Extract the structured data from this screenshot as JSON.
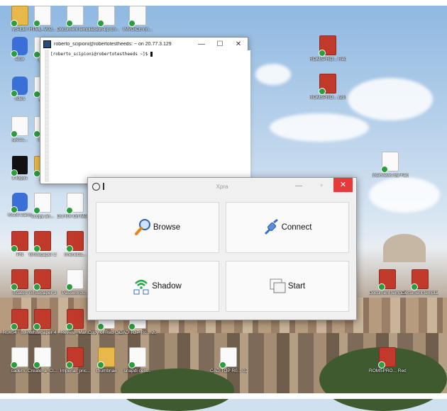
{
  "desktop": {
    "icons": [
      {
        "label": "yS-Elin",
        "kind": "folder"
      },
      {
        "label": "HTML_V02...",
        "kind": "doc"
      },
      {
        "label": "Document templates",
        "kind": "doc"
      },
      {
        "label": "Sign-up ch...",
        "kind": "doc"
      },
      {
        "label": "INVOICE (in...",
        "kind": "doc"
      },
      {
        "label": "efox",
        "kind": "app"
      },
      {
        "label": "Rec",
        "kind": "doc"
      },
      {
        "label": "ndes",
        "kind": "app"
      },
      {
        "label": "Wo",
        "kind": "doc"
      },
      {
        "label": "gress...",
        "kind": "doc"
      },
      {
        "label": "mtov",
        "kind": "doc"
      },
      {
        "label": "k-logos",
        "kind": "black"
      },
      {
        "label": "ph",
        "kind": "folder"
      },
      {
        "label": "rosoft eams",
        "kind": "app"
      },
      {
        "label": "ecopy an...",
        "kind": "doc"
      },
      {
        "label": "Dst RX-Off Mer-Ltcy-Ag...",
        "kind": "doc"
      },
      {
        "label": "PN",
        "kind": "pdf"
      },
      {
        "label": "Whitepaper 2",
        "kind": "pdf"
      },
      {
        "label": "Imeneba...",
        "kind": "pdf"
      },
      {
        "label": "ificates",
        "kind": "pdf"
      },
      {
        "label": "Whitepaper 3",
        "kind": "pdf"
      },
      {
        "label": "Passwords...",
        "kind": "doc"
      },
      {
        "label": "R0X04 - 03-No...",
        "kind": "pdf"
      },
      {
        "label": "Whitepaper 4",
        "kind": "pdf"
      },
      {
        "label": "Review_Mar...",
        "kind": "pdf"
      },
      {
        "label": "Copy of Red Oak...",
        "kind": "doc"
      },
      {
        "label": "CAD TOP Ro... 20-FEB-23...",
        "kind": "doc"
      },
      {
        "label": "cadem...",
        "kind": "doc"
      },
      {
        "label": "Create_a_Cl...",
        "kind": "doc"
      },
      {
        "label": "Imperial_pric...",
        "kind": "pdf"
      },
      {
        "label": "thumbnail",
        "kind": "folder"
      },
      {
        "label": "snapdi cent...",
        "kind": "doc"
      },
      {
        "label": "CAD TOP R0... 02-Feb-23...",
        "kind": "doc"
      },
      {
        "label": "ROMSPRO... Red Oak M...",
        "kind": "pdf"
      },
      {
        "label": "ROMSPRO... (2) Mer Co...",
        "kind": "pdf"
      },
      {
        "label": "Interviews By Faculty",
        "kind": "doc"
      },
      {
        "label": "Document template",
        "kind": "pdf"
      },
      {
        "label": "Document template2",
        "kind": "pdf"
      },
      {
        "label": "ROMSPRO... Red Oak M...",
        "kind": "pdf"
      }
    ]
  },
  "terminal": {
    "title": "roberto_scipioni@robertotestheeds: ~ on 20.77.3.129",
    "prompt": "[roberto_scipioni@robertotestheeds ~]$ ",
    "minimize": "—",
    "maximize": "☐",
    "close": "✕"
  },
  "xpra": {
    "title": "Xpra",
    "minimize": "—",
    "maximize": "▫",
    "close": "✕",
    "buttons": {
      "browse": "Browse",
      "connect": "Connect",
      "shadow": "Shadow",
      "start": "Start"
    }
  }
}
